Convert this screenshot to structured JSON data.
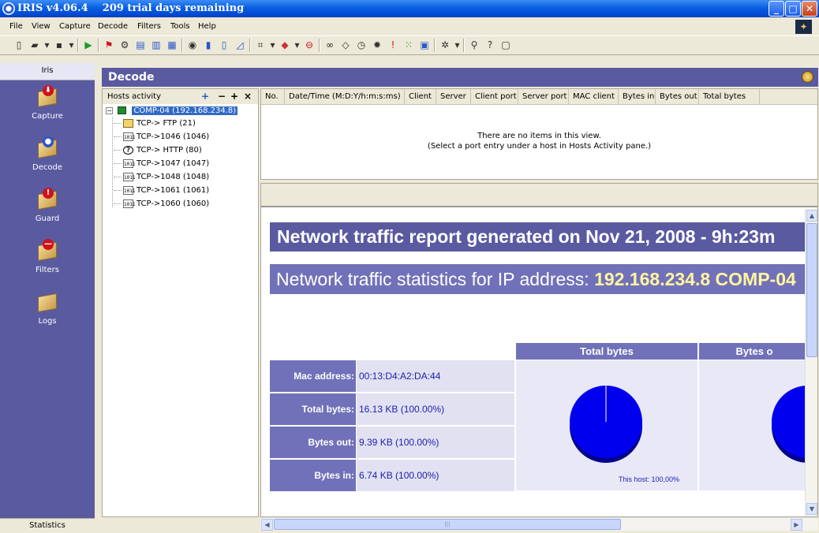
{
  "window": {
    "title": "IRIS v4.06.4    209 trial days remaining",
    "minimize": "_",
    "maximize": "□",
    "close": "✕"
  },
  "menu": [
    "File",
    "View",
    "Capture",
    "Decode",
    "Filters",
    "Tools",
    "Help"
  ],
  "toolbar": {
    "icons": [
      "new-icon",
      "open-icon",
      "dropdown-arrow-icon",
      "save-icon",
      "dropdown-arrow-icon",
      "start-capture-icon",
      "flag-icon",
      "decode-settings-icon",
      "packet-list-icon",
      "view-pane-icon",
      "view-pane-2-icon",
      "hosts-icon",
      "bar-chart-icon",
      "column-chart-icon",
      "line-chart-icon",
      "filter-icon",
      "dropdown-arrow-icon",
      "guard-icon",
      "dropdown-arrow-icon",
      "stop-icon",
      "binoculars-icon",
      "diamond-icon",
      "clock-icon",
      "alarm-icon",
      "exclamation-icon",
      "tree-icon",
      "note-icon",
      "plugin-icon",
      "dropdown-arrow-icon",
      "search-help-icon",
      "whats-this-icon",
      "help-icon"
    ]
  },
  "sidebar": {
    "header": "Iris",
    "items": [
      {
        "label": "Capture",
        "icon": "capture-icon",
        "mark": "⬇",
        "markColor": "#d0121c"
      },
      {
        "label": "Decode",
        "icon": "decode-icon",
        "mark": "●",
        "markColor": "#2b55c9"
      },
      {
        "label": "Guard",
        "icon": "guard-icon",
        "mark": "!",
        "markColor": "#d0121c"
      },
      {
        "label": "Filters",
        "icon": "filters-icon",
        "mark": "—",
        "markColor": "#d0121c"
      },
      {
        "label": "Logs",
        "icon": "logs-icon",
        "mark": "",
        "markColor": "#ffffff"
      }
    ],
    "footer": "Statistics"
  },
  "decode": {
    "title": "Decode"
  },
  "hosts": {
    "title": "Hosts activity",
    "controls": [
      "+",
      "−",
      "+",
      "×"
    ],
    "root": "COMP-04 (192.168.234.8)",
    "children": [
      {
        "label": "TCP-> FTP (21)",
        "icon": "ftp"
      },
      {
        "label": "TCP->1046 (1046)",
        "icon": "bin"
      },
      {
        "label": "TCP-> HTTP (80)",
        "icon": "q"
      },
      {
        "label": "TCP->1047 (1047)",
        "icon": "bin"
      },
      {
        "label": "TCP->1048 (1048)",
        "icon": "bin"
      },
      {
        "label": "TCP->1061 (1061)",
        "icon": "bin"
      },
      {
        "label": "TCP->1060 (1060)",
        "icon": "bin"
      }
    ]
  },
  "list": {
    "columns": [
      "No.",
      "Date/Time (M:D:Y/h:m:s:ms)",
      "Client",
      "Server",
      "Client port",
      "Server port",
      "MAC client",
      "Bytes in",
      "Bytes out",
      "Total bytes"
    ],
    "empty1": "There are no items in this view.",
    "empty2": "(Select a port entry under a host in Hosts Activity pane.)"
  },
  "report": {
    "heading": "Network traffic report generated on  Nov 21, 2008 - 9h:23m",
    "statsPrefix": "Network traffic statistics for IP address: ",
    "statsIp": "192.168.234.8 COMP-04",
    "tableHeaders": [
      "Total bytes",
      "Bytes o"
    ],
    "rows": [
      {
        "label": "Mac address:",
        "value": "00:13:D4:A2:DA:44"
      },
      {
        "label": "Total bytes:",
        "value": "16.13 KB (100.00%)"
      },
      {
        "label": "Bytes out:",
        "value": "9.39 KB (100.00%)"
      },
      {
        "label": "Bytes in:",
        "value": "6.74 KB (100.00%)"
      }
    ],
    "pieCaption": "This host: 100,00%",
    "pieColor": "#0000ee"
  },
  "scroll": {
    "grip": "|||"
  }
}
